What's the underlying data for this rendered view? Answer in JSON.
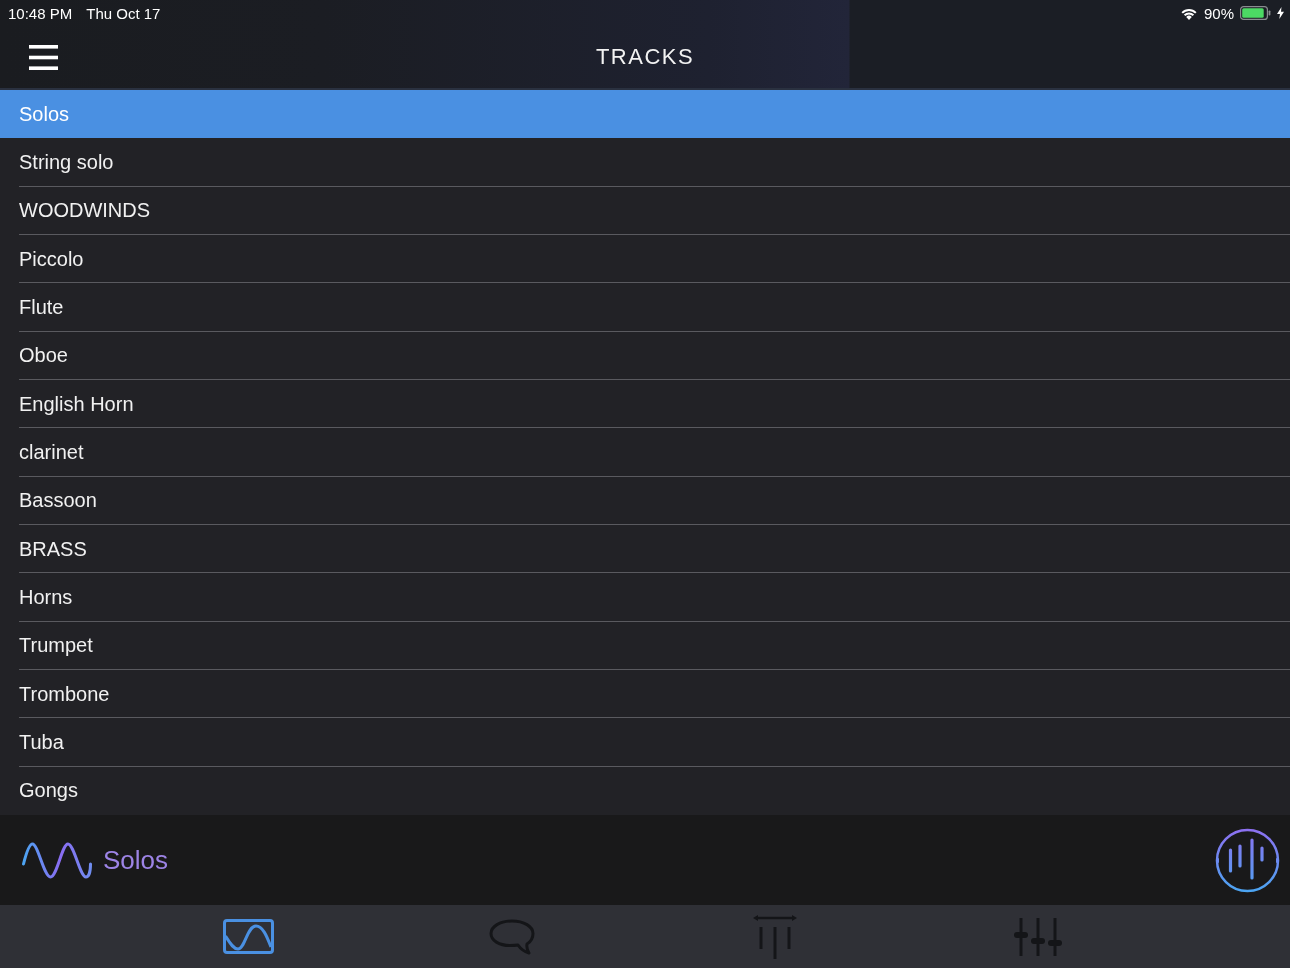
{
  "status_bar": {
    "time": "10:48 PM",
    "date": "Thu Oct 17",
    "battery": "90%",
    "charging": true
  },
  "nav_bar": {
    "title": "TRACKS"
  },
  "tracks": [
    {
      "name": "Solos",
      "selected": true
    },
    {
      "name": "String solo",
      "selected": false
    },
    {
      "name": "WOODWINDS",
      "selected": false
    },
    {
      "name": "Piccolo",
      "selected": false
    },
    {
      "name": "Flute",
      "selected": false
    },
    {
      "name": "Oboe",
      "selected": false
    },
    {
      "name": "English Horn",
      "selected": false
    },
    {
      "name": "clarinet",
      "selected": false
    },
    {
      "name": "Bassoon",
      "selected": false
    },
    {
      "name": "BRASS",
      "selected": false
    },
    {
      "name": "Horns",
      "selected": false
    },
    {
      "name": "Trumpet",
      "selected": false
    },
    {
      "name": "Trombone",
      "selected": false
    },
    {
      "name": "Tuba",
      "selected": false
    },
    {
      "name": "Gongs",
      "selected": false
    }
  ],
  "now_playing": {
    "title": "Solos"
  },
  "tab_bar": [
    {
      "kind": "curve",
      "selected": true
    },
    {
      "kind": "speech",
      "selected": false
    },
    {
      "kind": "spread",
      "selected": false
    },
    {
      "kind": "mixer",
      "selected": false
    }
  ]
}
